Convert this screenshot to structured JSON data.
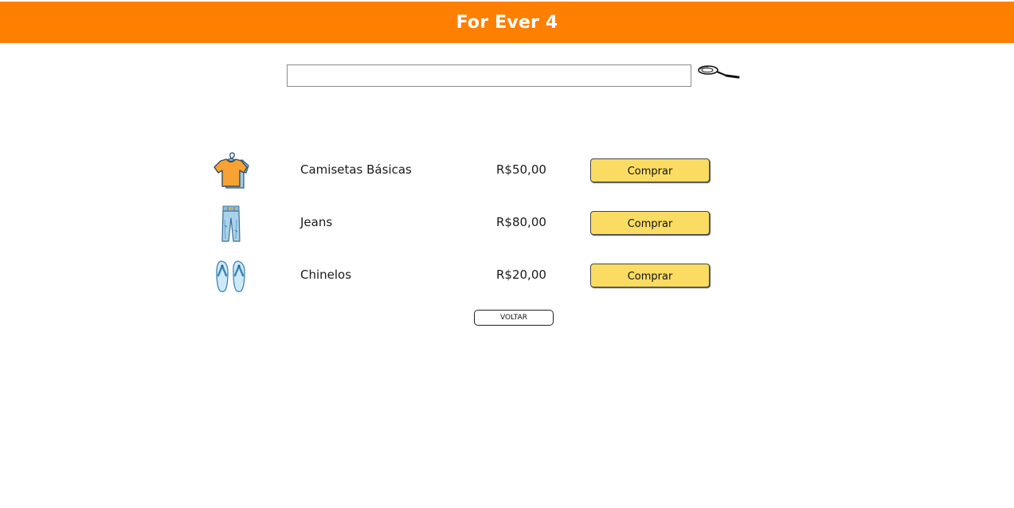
{
  "header": {
    "title": "For Ever 4",
    "background_color": "#ff7f00",
    "text_color": "#ffffff"
  },
  "search": {
    "value": "",
    "placeholder": "",
    "button_icon": "magnifying-glass-icon"
  },
  "products": [
    {
      "name": "Camisetas Básicas",
      "price": "R$50,00",
      "icon": "tshirt-icon",
      "button_label": "Comprar"
    },
    {
      "name": "Jeans",
      "price": "R$80,00",
      "icon": "jeans-icon",
      "button_label": "Comprar"
    },
    {
      "name": "Chinelos",
      "price": "R$20,00",
      "icon": "flip-flops-icon",
      "button_label": "Comprar"
    }
  ],
  "buy_button_color": "#fbdc63",
  "back_button": {
    "label": "VOLTAR"
  }
}
